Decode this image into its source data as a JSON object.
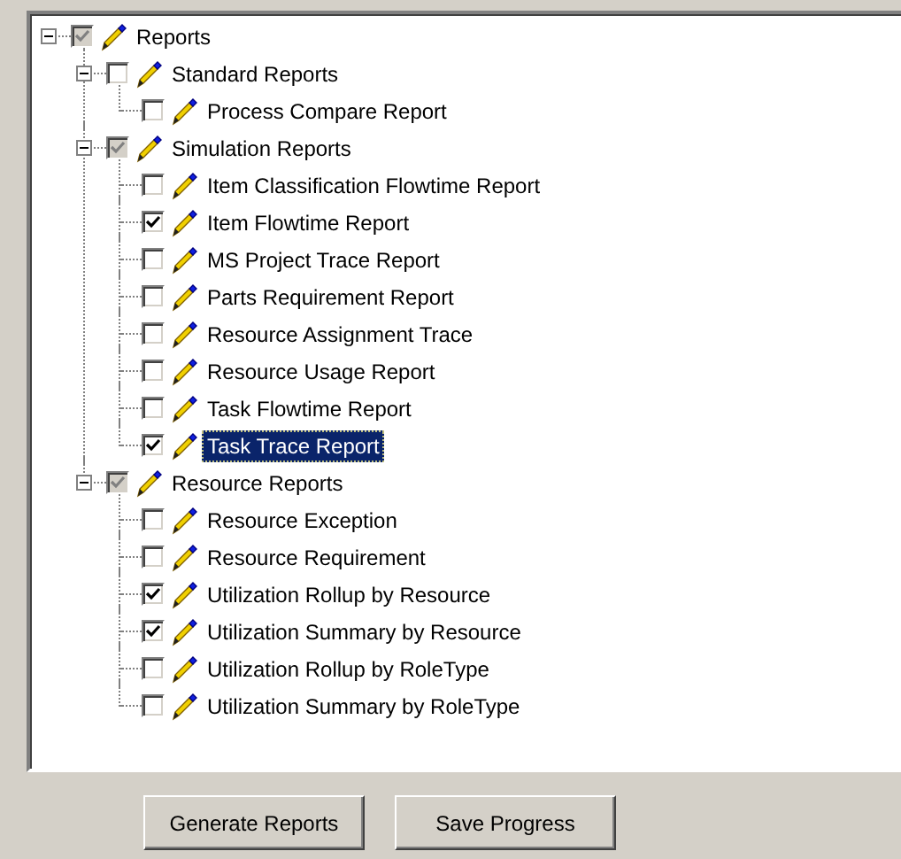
{
  "tree": [
    {
      "label": "Reports",
      "checked": true,
      "greyed": true,
      "selected": false,
      "expanded": true,
      "children": [
        {
          "label": "Standard Reports",
          "checked": false,
          "selected": false,
          "expanded": true,
          "children": [
            {
              "label": "Process Compare Report",
              "checked": false,
              "selected": false
            }
          ]
        },
        {
          "label": "Simulation Reports",
          "checked": true,
          "greyed": true,
          "selected": false,
          "expanded": true,
          "children": [
            {
              "label": "Item Classification Flowtime Report",
              "checked": false,
              "selected": false
            },
            {
              "label": "Item Flowtime Report",
              "checked": true,
              "greyed": false,
              "selected": false
            },
            {
              "label": "MS Project Trace Report",
              "checked": false,
              "selected": false
            },
            {
              "label": "Parts Requirement Report",
              "checked": false,
              "selected": false
            },
            {
              "label": "Resource Assignment Trace",
              "checked": false,
              "selected": false
            },
            {
              "label": "Resource Usage Report",
              "checked": false,
              "selected": false
            },
            {
              "label": "Task Flowtime Report",
              "checked": false,
              "selected": false
            },
            {
              "label": "Task Trace Report",
              "checked": true,
              "greyed": false,
              "selected": true
            }
          ]
        },
        {
          "label": "Resource Reports",
          "checked": true,
          "greyed": true,
          "selected": false,
          "expanded": true,
          "children": [
            {
              "label": "Resource Exception",
              "checked": false,
              "selected": false
            },
            {
              "label": "Resource Requirement",
              "checked": false,
              "selected": false
            },
            {
              "label": "Utilization Rollup by Resource",
              "checked": true,
              "greyed": false,
              "selected": false
            },
            {
              "label": "Utilization Summary by Resource",
              "checked": true,
              "greyed": false,
              "selected": false
            },
            {
              "label": "Utilization Rollup by RoleType",
              "checked": false,
              "selected": false
            },
            {
              "label": "Utilization Summary by RoleType",
              "checked": false,
              "selected": false
            }
          ]
        }
      ]
    }
  ],
  "buttons": [
    {
      "label": "Generate Reports"
    },
    {
      "label": "Save Progress"
    }
  ]
}
